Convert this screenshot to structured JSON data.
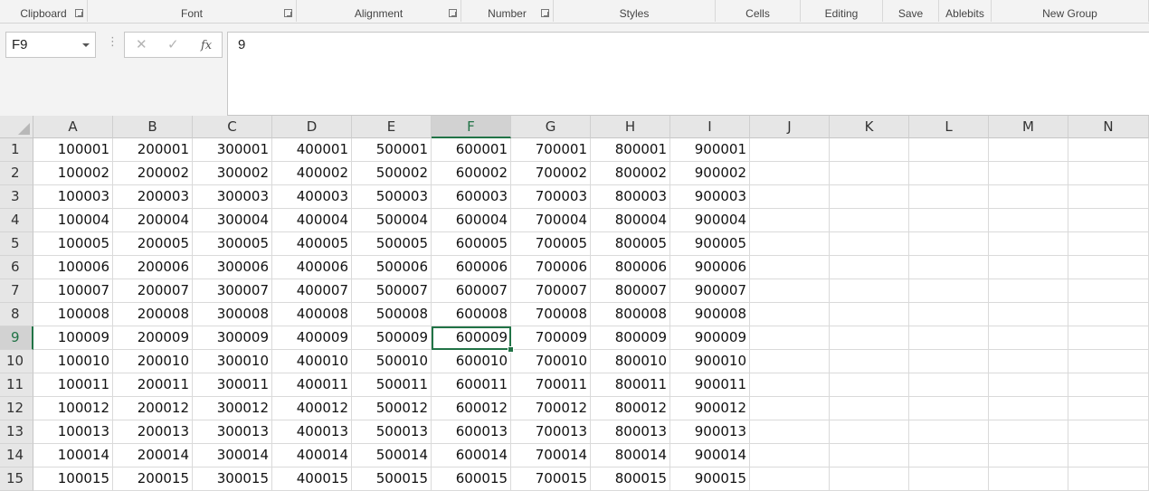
{
  "ribbon": {
    "groups": [
      {
        "label": "Clipboard",
        "launcher": true
      },
      {
        "label": "Font",
        "launcher": true
      },
      {
        "label": "Alignment",
        "launcher": true
      },
      {
        "label": "Number",
        "launcher": true
      },
      {
        "label": "Styles",
        "launcher": false
      },
      {
        "label": "Cells",
        "launcher": false
      },
      {
        "label": "Editing",
        "launcher": false
      },
      {
        "label": "Save",
        "launcher": false
      },
      {
        "label": "Ablebits",
        "launcher": false
      },
      {
        "label": "New Group",
        "launcher": false
      }
    ]
  },
  "formula_bar": {
    "name_box": "F9",
    "separator": "⋮",
    "cancel_icon": "✕",
    "enter_icon": "✓",
    "function_icon": "fx",
    "formula_value": "9"
  },
  "sheet": {
    "columns": [
      "A",
      "B",
      "C",
      "D",
      "E",
      "F",
      "G",
      "H",
      "I",
      "J",
      "K",
      "L",
      "M",
      "N"
    ],
    "selected_column": "F",
    "selected_row": 9,
    "active_cell": "F9",
    "rows": [
      {
        "num": "1",
        "cells": [
          "100001",
          "200001",
          "300001",
          "400001",
          "500001",
          "600001",
          "700001",
          "800001",
          "900001"
        ]
      },
      {
        "num": "2",
        "cells": [
          "100002",
          "200002",
          "300002",
          "400002",
          "500002",
          "600002",
          "700002",
          "800002",
          "900002"
        ]
      },
      {
        "num": "3",
        "cells": [
          "100003",
          "200003",
          "300003",
          "400003",
          "500003",
          "600003",
          "700003",
          "800003",
          "900003"
        ]
      },
      {
        "num": "4",
        "cells": [
          "100004",
          "200004",
          "300004",
          "400004",
          "500004",
          "600004",
          "700004",
          "800004",
          "900004"
        ]
      },
      {
        "num": "5",
        "cells": [
          "100005",
          "200005",
          "300005",
          "400005",
          "500005",
          "600005",
          "700005",
          "800005",
          "900005"
        ]
      },
      {
        "num": "6",
        "cells": [
          "100006",
          "200006",
          "300006",
          "400006",
          "500006",
          "600006",
          "700006",
          "800006",
          "900006"
        ]
      },
      {
        "num": "7",
        "cells": [
          "100007",
          "200007",
          "300007",
          "400007",
          "500007",
          "600007",
          "700007",
          "800007",
          "900007"
        ]
      },
      {
        "num": "8",
        "cells": [
          "100008",
          "200008",
          "300008",
          "400008",
          "500008",
          "600008",
          "700008",
          "800008",
          "900008"
        ]
      },
      {
        "num": "9",
        "cells": [
          "100009",
          "200009",
          "300009",
          "400009",
          "500009",
          "600009",
          "700009",
          "800009",
          "900009"
        ]
      },
      {
        "num": "10",
        "cells": [
          "100010",
          "200010",
          "300010",
          "400010",
          "500010",
          "600010",
          "700010",
          "800010",
          "900010"
        ]
      },
      {
        "num": "11",
        "cells": [
          "100011",
          "200011",
          "300011",
          "400011",
          "500011",
          "600011",
          "700011",
          "800011",
          "900011"
        ]
      },
      {
        "num": "12",
        "cells": [
          "100012",
          "200012",
          "300012",
          "400012",
          "500012",
          "600012",
          "700012",
          "800012",
          "900012"
        ]
      },
      {
        "num": "13",
        "cells": [
          "100013",
          "200013",
          "300013",
          "400013",
          "500013",
          "600013",
          "700013",
          "800013",
          "900013"
        ]
      },
      {
        "num": "14",
        "cells": [
          "100014",
          "200014",
          "300014",
          "400014",
          "500014",
          "600014",
          "700014",
          "800014",
          "900014"
        ]
      },
      {
        "num": "15",
        "cells": [
          "100015",
          "200015",
          "300015",
          "400015",
          "500015",
          "600015",
          "700015",
          "800015",
          "900015"
        ]
      }
    ]
  },
  "colors": {
    "accent": "#217346",
    "header_bg": "#e6e6e6",
    "ribbon_bg": "#f3f3f3"
  }
}
